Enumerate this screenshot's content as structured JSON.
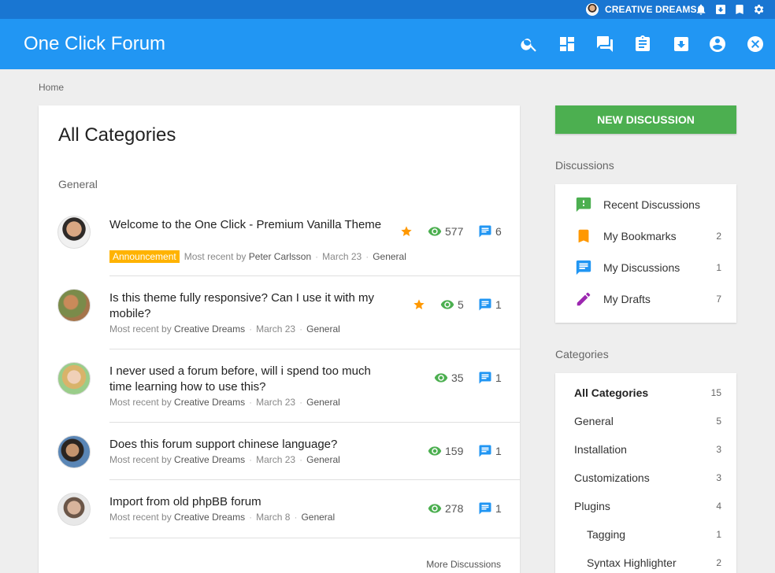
{
  "colors": {
    "topbar": "#1976d2",
    "header": "#2196f3",
    "accent_green": "#4caf50",
    "star": "#ff9800",
    "views": "#4caf50",
    "comments": "#2196f3",
    "badge": "#ffb300",
    "drafts": "#9c27b0"
  },
  "userbar": {
    "username": "CREATIVE DREAMS",
    "icons": [
      "bell-icon",
      "download-box-icon",
      "bookmark-icon",
      "gear-icon"
    ]
  },
  "header": {
    "title": "One Click Forum",
    "icons": [
      "search-icon",
      "dashboard-icon",
      "forum-icon",
      "clipboard-icon",
      "download-box-icon",
      "account-icon",
      "close-circle-icon"
    ]
  },
  "breadcrumb": "Home",
  "main": {
    "title": "All Categories",
    "section": "General",
    "discussions": [
      {
        "title": "Welcome to the One Click - Premium Vanilla Theme",
        "badge": "Announcement",
        "most_recent_prefix": "Most recent by",
        "user": "Peter Carlsson",
        "date": "March 23",
        "category": "General",
        "starred": true,
        "views": "577",
        "comments": "6"
      },
      {
        "title": "Is this theme fully responsive? Can I use it with my mobile?",
        "badge": "",
        "most_recent_prefix": "Most recent by",
        "user": "Creative Dreams",
        "date": "March 23",
        "category": "General",
        "starred": true,
        "views": "5",
        "comments": "1"
      },
      {
        "title": "I never used a forum before, will i spend too much time learning how to use this?",
        "badge": "",
        "most_recent_prefix": "Most recent by",
        "user": "Creative Dreams",
        "date": "March 23",
        "category": "General",
        "starred": false,
        "views": "35",
        "comments": "1"
      },
      {
        "title": "Does this forum support chinese language?",
        "badge": "",
        "most_recent_prefix": "Most recent by",
        "user": "Creative Dreams",
        "date": "March 23",
        "category": "General",
        "starred": false,
        "views": "159",
        "comments": "1"
      },
      {
        "title": "Import from old phpBB forum",
        "badge": "",
        "most_recent_prefix": "Most recent by",
        "user": "Creative Dreams",
        "date": "March 8",
        "category": "General",
        "starred": false,
        "views": "278",
        "comments": "1"
      }
    ],
    "more_link": "More Discussions"
  },
  "sidebar": {
    "new_discussion": "NEW DISCUSSION",
    "discussions_label": "Discussions",
    "discussions": [
      {
        "label": "Recent Discussions",
        "count": "",
        "icon": "alert-message-icon"
      },
      {
        "label": "My Bookmarks",
        "count": "2",
        "icon": "bookmark-icon"
      },
      {
        "label": "My Discussions",
        "count": "1",
        "icon": "message-icon"
      },
      {
        "label": "My Drafts",
        "count": "7",
        "icon": "pencil-icon"
      }
    ],
    "categories_label": "Categories",
    "categories": [
      {
        "label": "All Categories",
        "count": "15"
      },
      {
        "label": "General",
        "count": "5"
      },
      {
        "label": "Installation",
        "count": "3"
      },
      {
        "label": "Customizations",
        "count": "3"
      },
      {
        "label": "Plugins",
        "count": "4"
      },
      {
        "label": "Tagging",
        "count": "1"
      },
      {
        "label": "Syntax Highlighter",
        "count": "2"
      }
    ]
  }
}
